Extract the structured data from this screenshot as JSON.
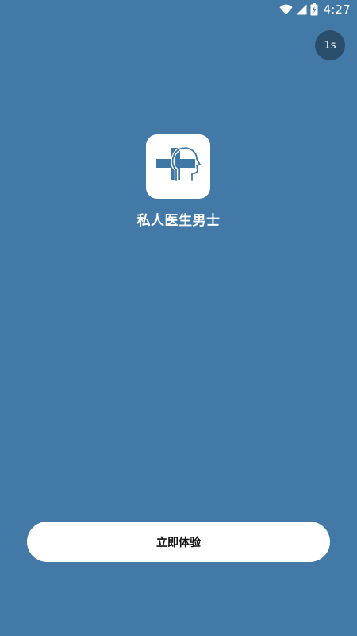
{
  "status_bar": {
    "time": "4:27",
    "icons": [
      "wifi-icon",
      "cell-signal-icon",
      "battery-charging-icon"
    ]
  },
  "splash": {
    "countdown": "1s",
    "app_name": "私人医生男士",
    "logo_icon": "medical-cross-head-icon",
    "start_button_label": "立即体验"
  },
  "colors": {
    "background": "#4279a7",
    "badge": "#2b4d6c",
    "button": "#ffffff",
    "logo_accent": "#3f77a5"
  }
}
